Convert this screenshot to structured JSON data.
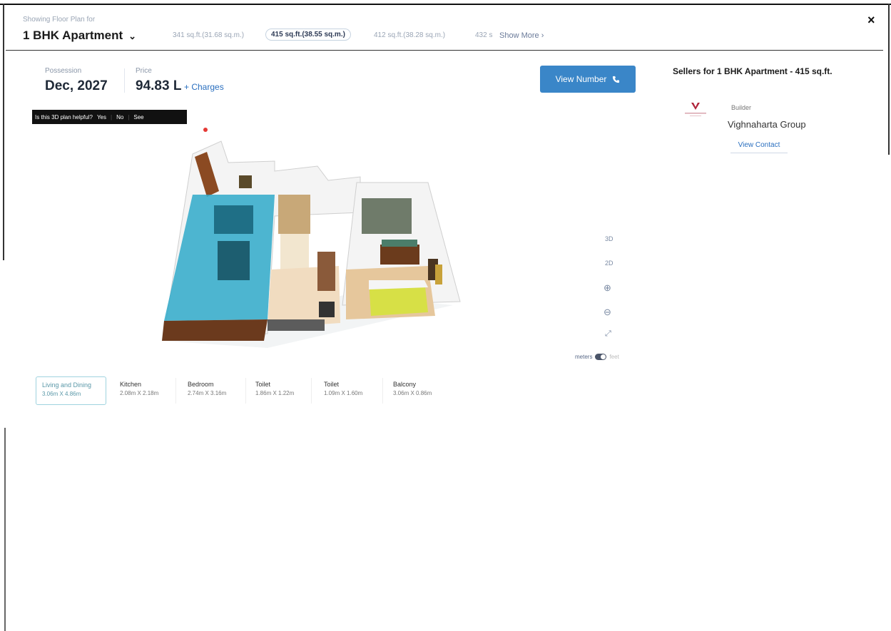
{
  "header": {
    "showing_label": "Showing Floor Plan for",
    "floor_type": "1 BHK Apartment",
    "sizes": [
      {
        "label": "341 sq.ft.(31.68 sq.m.)",
        "active": false
      },
      {
        "label": "415 sq.ft.(38.55 sq.m.)",
        "active": true
      },
      {
        "label": "412 sq.ft.(38.28 sq.m.)",
        "active": false
      },
      {
        "label": "432 s",
        "active": false
      }
    ],
    "show_more": "Show More",
    "close": "×"
  },
  "summary": {
    "possession_label": "Possession",
    "possession_value": "Dec, 2027",
    "price_label": "Price",
    "price_value": "94.83 L",
    "charges": "+ Charges"
  },
  "feedback": {
    "question": "Is this 3D plan helpful?",
    "yes": "Yes",
    "no": "No",
    "see": "See"
  },
  "actions": {
    "view_number": "View Number",
    "phone_icon": "phone-icon"
  },
  "sellers": {
    "title": "Sellers for 1 BHK Apartment - 415 sq.ft.",
    "builder_label": "Builder",
    "builder_name": "Vighnaharta Group",
    "view_contact": "View Contact"
  },
  "view_controls": {
    "mode_3d": "3D",
    "mode_2d": "2D",
    "unit_meters": "meters",
    "unit_feet": "feet"
  },
  "rooms": [
    {
      "name": "Living and Dining",
      "dims": "3.06m X 4.86m",
      "active": true
    },
    {
      "name": "Kitchen",
      "dims": "2.08m X 2.18m",
      "active": false
    },
    {
      "name": "Bedroom",
      "dims": "2.74m X 3.16m",
      "active": false
    },
    {
      "name": "Toilet",
      "dims": "1.86m X 1.22m",
      "active": false
    },
    {
      "name": "Toilet",
      "dims": "1.09m X 1.60m",
      "active": false
    },
    {
      "name": "Balcony",
      "dims": "3.06m X 0.86m",
      "active": false
    }
  ],
  "colors": {
    "accent_blue": "#3a86c8",
    "living_highlight": "#2fa9c9",
    "bed_yellow": "#d7e046"
  }
}
